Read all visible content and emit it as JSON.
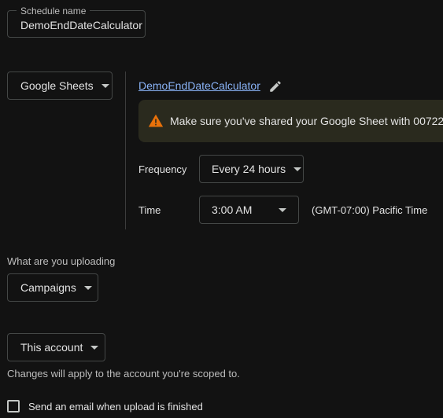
{
  "schedule_name": {
    "legend": "Schedule name",
    "value": "DemoEndDateCalculator"
  },
  "source": {
    "selected": "Google Sheets",
    "sheet_link": "DemoEndDateCalculator",
    "edit_icon": "pencil-icon"
  },
  "warning": {
    "icon": "warning-triangle-icon",
    "color": "#e8710a",
    "text": "Make sure you've shared your Google Sheet with 00722"
  },
  "frequency": {
    "label": "Frequency",
    "value": "Every 24 hours"
  },
  "time": {
    "label": "Time",
    "value": "3:00 AM",
    "timezone": "(GMT-07:00) Pacific Time"
  },
  "upload": {
    "label": "What are you uploading",
    "selected": "Campaigns"
  },
  "account": {
    "selected": "This account",
    "helper": "Changes will apply to the account you're scoped to."
  },
  "email": {
    "label": "Send an email when upload is finished",
    "checked": false
  },
  "colors": {
    "background": "#121212",
    "link": "#8ab4f8",
    "outline": "#444746"
  }
}
